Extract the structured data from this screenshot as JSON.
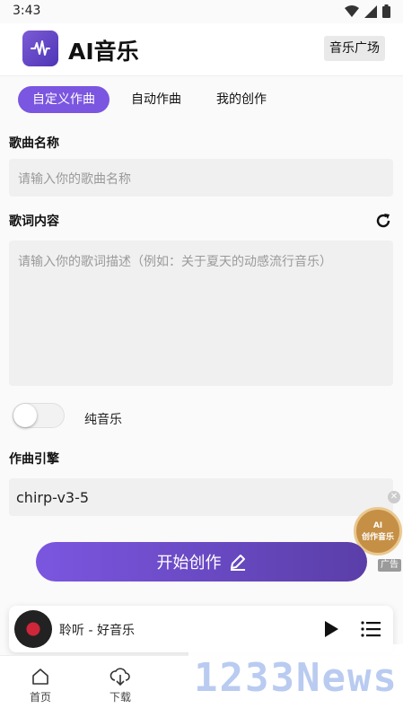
{
  "status_bar": {
    "time": "3:43",
    "icons": [
      "wifi-icon",
      "signal-icon",
      "battery-icon"
    ]
  },
  "header": {
    "app_title": "AI音乐",
    "plaza_button": "音乐广场"
  },
  "tabs": [
    {
      "label": "自定义作曲",
      "active": true
    },
    {
      "label": "自动作曲",
      "active": false
    },
    {
      "label": "我的创作",
      "active": false
    }
  ],
  "form": {
    "song_name_label": "歌曲名称",
    "song_name_placeholder": "请输入你的歌曲名称",
    "lyrics_label": "歌词内容",
    "lyrics_placeholder": "请输入你的歌词描述（例如：关于夏天的动感流行音乐）",
    "instrumental_label": "纯音乐",
    "instrumental_on": false,
    "engine_label": "作曲引擎",
    "engine_value": "chirp-v3-5",
    "start_button": "开始创作"
  },
  "ad": {
    "line1": "AI",
    "line2": "创作音乐",
    "tag": "广告"
  },
  "player": {
    "title": "聆听 - 好音乐"
  },
  "bottom_nav": [
    {
      "label": "首页",
      "icon": "home-icon"
    },
    {
      "label": "下载",
      "icon": "download-icon"
    }
  ],
  "watermark": "1233News",
  "colors": {
    "accent": "#7b56e0",
    "accent_dark": "#5a3ea8"
  }
}
